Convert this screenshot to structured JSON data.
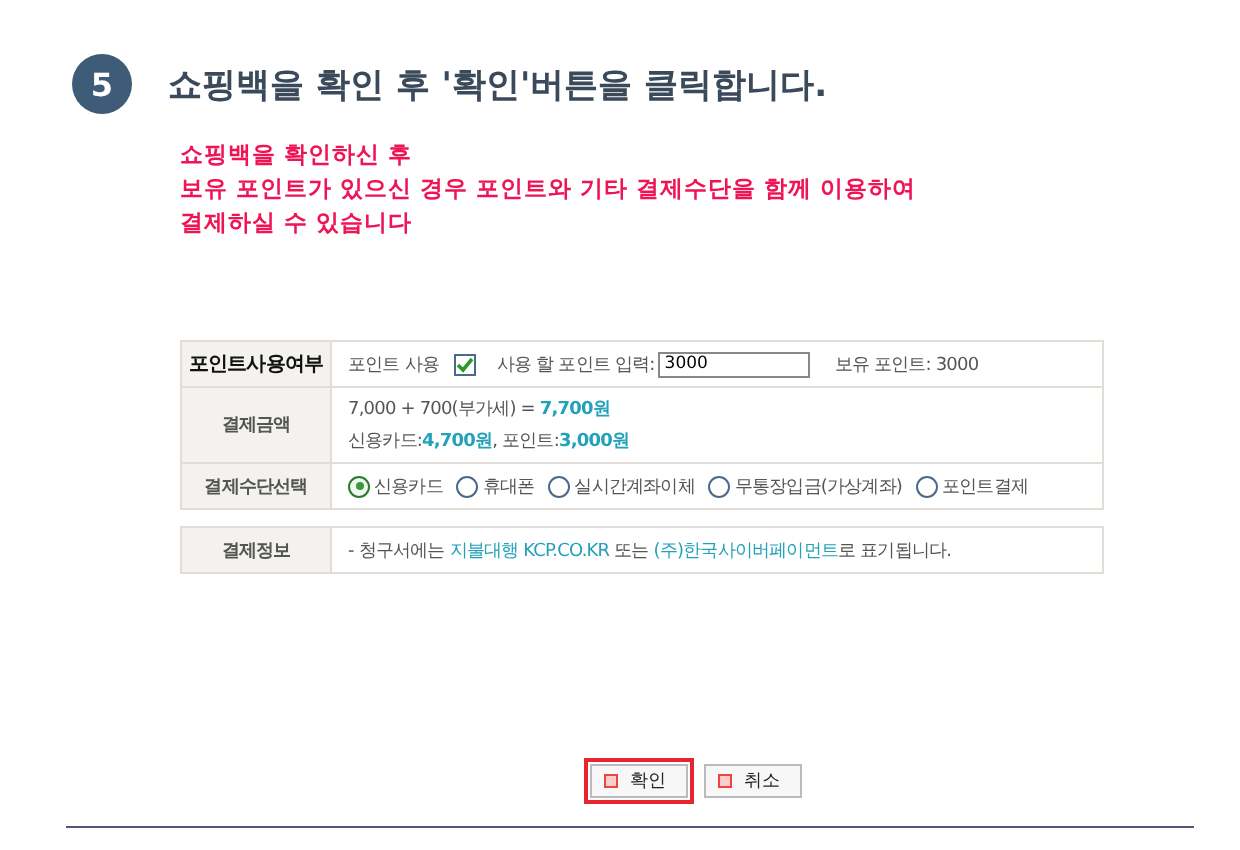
{
  "step": {
    "number": "5",
    "title": "쇼핑백을 확인 후 '확인'버튼을 클릭합니다."
  },
  "notice": [
    "쇼핑백을 확인하신 후",
    "보유 포인트가 있으신 경우 포인트와 기타 결제수단을 함께 이용하여",
    "결제하실 수 있습니다"
  ],
  "point_row": {
    "label": "포인트사용여부",
    "use_label": "포인트 사용",
    "checked": true,
    "input_label": "사용 할 포인트 입력:",
    "input_value": "3000",
    "balance": "보유 포인트: 3000"
  },
  "amount_row": {
    "label": "결제금액",
    "lines": [
      [
        {
          "text": "7,000 + 700(부가세) = ",
          "emph": false
        },
        {
          "text": "7,700원",
          "emph": true
        }
      ],
      [
        {
          "text": "신용카드:",
          "emph": false
        },
        {
          "text": "4,700원",
          "emph": true
        },
        {
          "text": ", 포인트:",
          "emph": false
        },
        {
          "text": "3,000원",
          "emph": true
        }
      ]
    ]
  },
  "method_row": {
    "label": "결제수단선택",
    "options": [
      {
        "label": "신용카드",
        "selected": true
      },
      {
        "label": "휴대폰",
        "selected": false
      },
      {
        "label": "실시간계좌이체",
        "selected": false
      },
      {
        "label": "무통장입금(가상계좌)",
        "selected": false
      },
      {
        "label": "포인트결제",
        "selected": false
      }
    ]
  },
  "info_row": {
    "label": "결제정보",
    "segments": [
      {
        "text": "- 청구서에는 ",
        "link": false
      },
      {
        "text": "지불대행 KCP.CO.KR",
        "link": true
      },
      {
        "text": " 또는 ",
        "link": false
      },
      {
        "text": "(주)한국사이버페이먼트",
        "link": true
      },
      {
        "text": "로 표기됩니다.",
        "link": false
      }
    ]
  },
  "buttons": [
    {
      "label": "확인",
      "highlighted": true
    },
    {
      "label": "취소",
      "highlighted": false
    }
  ]
}
